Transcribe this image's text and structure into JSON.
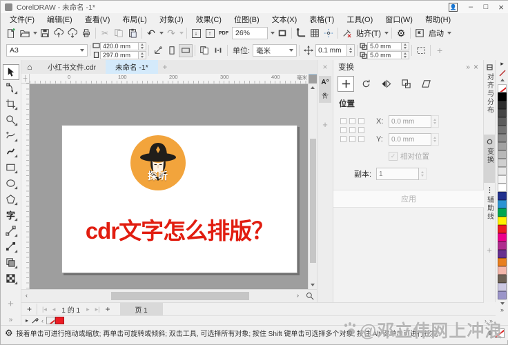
{
  "window": {
    "title": "CorelDRAW - 未命名 -1*"
  },
  "menu": {
    "items": [
      "文件(F)",
      "编辑(E)",
      "查看(V)",
      "布局(L)",
      "对象(J)",
      "效果(C)",
      "位图(B)",
      "文本(X)",
      "表格(T)",
      "工具(O)",
      "窗口(W)",
      "帮助(H)"
    ]
  },
  "toolbar": {
    "zoom_value": "26%",
    "snap": "贴齐(T)",
    "launch": "启动"
  },
  "property_bar": {
    "page_size": "A3",
    "page_width": "420.0 mm",
    "page_height": "297.0 mm",
    "units_label": "单位:",
    "units_value": "毫米",
    "nudge_value": "0.1 mm",
    "duplicate_x": "5.0 mm",
    "duplicate_y": "5.0 mm"
  },
  "document_tabs": {
    "tab1": "小红书文件.cdr",
    "tab2": "未命名 -1*"
  },
  "rulers": {
    "h_ticks": [
      "0",
      "100",
      "200",
      "300",
      "400"
    ],
    "unit_label": "毫米"
  },
  "canvas": {
    "logo_text": "探听",
    "headline": "cdr文字怎么排版？",
    "colors": {
      "logo_bg": "#F2A43C",
      "headline": "#E11D10",
      "hat": "#211E1A"
    }
  },
  "transform_docker": {
    "title": "变换",
    "position_heading": "位置",
    "x_label": "X:",
    "x_value": "0.0 mm",
    "y_label": "Y:",
    "y_value": "0.0 mm",
    "relative_checkbox": "相对位置",
    "copies_label": "副本:",
    "copies_value": "1",
    "apply_button": "应用"
  },
  "docker_tabs": {
    "items": [
      "对齐与分布",
      "变换",
      "辅助线"
    ]
  },
  "page_controls": {
    "counter": "1 的 1",
    "page_tab": "页 1"
  },
  "status_bar": {
    "hint": "接着单击可进行拖动或缩放; 再单击可旋转或倾斜; 双击工具, 可选择所有对象; 按住 Shift 键单击可选择多个对象; 按住 Alt 键单击可进行挖掘"
  },
  "watermark": {
    "text": "@邓立伟网上冲浪"
  },
  "color_palette": {
    "colors": [
      "none",
      "#000000",
      "#2e2e2e",
      "#454545",
      "#5c5c5c",
      "#737373",
      "#8a8a8a",
      "#a1a1a1",
      "#b8b8b8",
      "#cfcfcf",
      "#e6e6e6",
      "#f5f5f5",
      "#ffffff",
      "#20308e",
      "#2b93d3",
      "#00a650",
      "#fff200",
      "#ed1c24",
      "#ec008b",
      "#b02c8e",
      "#67308f",
      "#e87f1f",
      "#f4b7ab",
      "#6e6256",
      "#ccc8e2",
      "#9b95c9"
    ]
  },
  "document_palette": {
    "colors": [
      "none",
      "#ed1c24"
    ]
  },
  "glyphs": {
    "gear": "⚙",
    "scissors": "✂",
    "undo": "↶",
    "redo": "↷",
    "arrow_down": "↓",
    "arrow_up": "↑",
    "home": "⌂",
    "close": "×",
    "minimize": "–",
    "maximize": "□",
    "flyout": "»",
    "prev": "◂",
    "next": "▸",
    "first": "|◂",
    "last": "▸|",
    "left": "‹",
    "right": "›",
    "up": "˄",
    "down": "˅",
    "star": "☆",
    "text_a": "A°",
    "plus": "+",
    "text_tool": "字",
    "pdf_label": "PDF",
    "fill_diamond": "◆",
    "tab_close": "×",
    "corner": "┼"
  }
}
